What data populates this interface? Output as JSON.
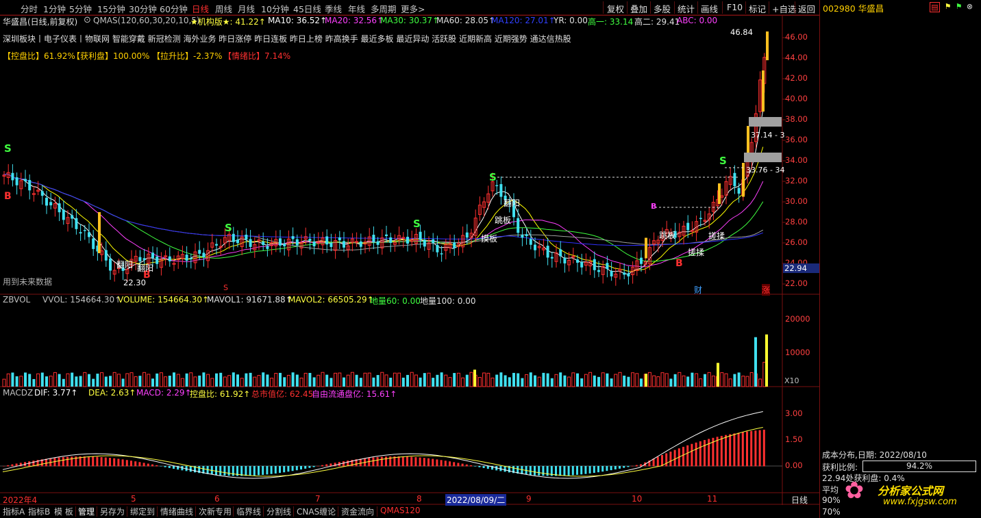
{
  "toolbar": {
    "periods": [
      "分时",
      "1分钟",
      "5分钟",
      "15分钟",
      "30分钟",
      "60分钟",
      "日线",
      "周线",
      "月线",
      "10分钟",
      "45日线",
      "季线",
      "年线",
      "多周期",
      "更多>"
    ],
    "active_period": "日线",
    "right_buttons": [
      "复权",
      "叠加",
      "多股",
      "统计",
      "画线",
      "F10",
      "标记",
      "+自选",
      "返回"
    ]
  },
  "stock": {
    "title": "华盛昌(日线,前复权)",
    "code_name": "002980 华盛昌"
  },
  "main_indicator": {
    "name": "QMAS(120,60,30,20,10,5)",
    "jigou": "★机构版★: 41.22↑",
    "ma10": "MA10: 36.52↑",
    "ma20": "MA20: 32.56↑",
    "ma30": "MA30: 30.37↑",
    "ma60": "MA60: 28.05↑",
    "ma120": "MA120: 27.01↑",
    "yr": "YR: 0.00",
    "gao1": "高一: 33.14",
    "gao2": "高二: 29.41",
    "abc": "ABC: 0.00"
  },
  "concepts": "深圳板块丨电子仪表丨物联网 智能穿戴 新冠检测  海外业务 昨日涨停 昨日连板 昨日上榜 昨高换手 最近多板 最近异动 活跃股 近期新高 近期强势 通达信热股",
  "ratios": {
    "kongpan": "【控盘比】61.92%",
    "huoli": "【获利盘】100.00%",
    "lasheng": "【拉升比】-2.37%",
    "qingxu": "【情绪比】7.14%"
  },
  "price_axis": [
    "46.00",
    "44.00",
    "42.00",
    "40.00",
    "38.00",
    "36.00",
    "34.00",
    "32.00",
    "30.00",
    "28.00",
    "26.00",
    "24.00",
    "22.00"
  ],
  "price_tag": "22.94",
  "annotations": {
    "high_price": "46.84",
    "low_price": "22.30",
    "level1": "37.14 - 3",
    "level2": "33.76 - 34",
    "future_data": "用到未来数据",
    "cai": "财",
    "zhang": "涨",
    "s_letter": "S",
    "b_letter": "B",
    "tag_fanyang": "翻阳",
    "tag_moban": "摸板",
    "tag_cuorou": "搓揉",
    "tag_tiaoban": "跳板"
  },
  "volume": {
    "name": "ZBVOL",
    "vvol": "VVOL: 154664.30↑",
    "volume": "VOLUME: 154664.30↑",
    "mavol1": "MAVOL1: 91671.88↑",
    "mavol2": "MAVOL2: 66505.29↑",
    "diliang60": "地量60: 0.00",
    "diliang100": "地量100: 0.00",
    "axis": [
      "20000",
      "10000"
    ],
    "unit": "X10"
  },
  "macd": {
    "name": "MACDZ",
    "dif": "DIF: 3.77↑",
    "dea": "DEA: 2.63↑",
    "macd": "MACD: 2.29↑",
    "kongpan": "控盘比: 61.92↑",
    "zongshizhi": "总市值亿: 62.45",
    "liutong": "自由流通盘亿: 15.61↑",
    "axis": [
      "3.00",
      "1.50",
      "0.00"
    ]
  },
  "date_axis": {
    "labels": [
      "2022年4",
      "5",
      "6",
      "7",
      "8",
      "9",
      "10",
      "11"
    ],
    "current_date": "2022/08/09/二",
    "period_label": "日线"
  },
  "bottom_tabs": [
    "指标A",
    "指标B",
    "模 板",
    "管理",
    "另存为",
    "绑定到",
    "情绪曲线",
    "次新专用",
    "临界线",
    "分割线",
    "CNAS缠论",
    "资金流向",
    "QMAS120"
  ],
  "side": {
    "cost_title": "成本分布,日期: 2022/08/10",
    "profit_label": "获利比例:",
    "profit_value": "94.2%",
    "profit_line": "22.94处获利盘: 0.4%",
    "avg_label": "平均",
    "pct90": "90%",
    "pct70": "70%",
    "logo_cn": "分析家公式网",
    "logo_url": "www.fxjgsw.com"
  },
  "colors": {
    "up": "#ff3030",
    "down": "#40e0f0",
    "ma5": "#ffffff",
    "ma10": "#ffff00",
    "ma20": "#ff40ff",
    "ma30": "#40ff40",
    "ma60": "#c0c0c0",
    "ma120": "#3030ff",
    "accent": "#ffd000"
  }
}
